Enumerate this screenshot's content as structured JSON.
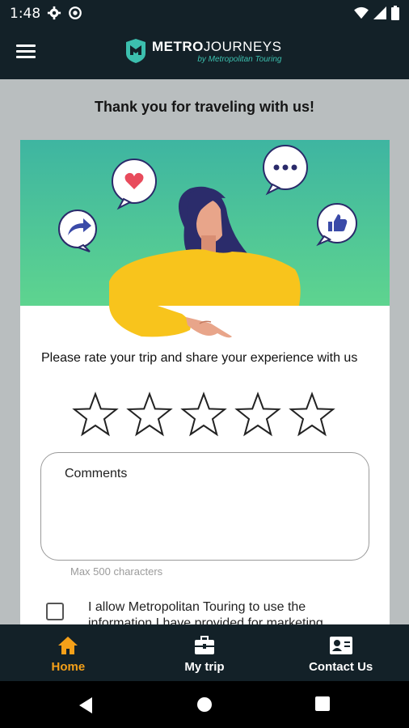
{
  "status_bar": {
    "time": "1:48",
    "left_icons": [
      "gear-icon",
      "sync-icon"
    ],
    "right_icons": [
      "wifi-icon",
      "signal-icon",
      "battery-icon"
    ]
  },
  "app_bar": {
    "menu_icon": "hamburger-menu-icon",
    "logo_bold": "METRO",
    "logo_light": "JOURNEYS",
    "logo_sub": "by Metropolitan Touring"
  },
  "page": {
    "title": "Thank you for traveling with us!"
  },
  "rating": {
    "prompt": "Please rate your trip and share your experience with us",
    "stars_total": 5,
    "stars_selected": 0
  },
  "comments": {
    "label": "Comments",
    "value": "",
    "helper": "Max 500 characters"
  },
  "consent": {
    "text": "I allow Metropolitan Touring to use the information I have provided for marketing",
    "checked": false
  },
  "bottom_nav": {
    "items": [
      {
        "label": "Home",
        "icon": "home-icon",
        "active": true
      },
      {
        "label": "My trip",
        "icon": "briefcase-icon",
        "active": false
      },
      {
        "label": "Contact Us",
        "icon": "contact-card-icon",
        "active": false
      }
    ]
  },
  "colors": {
    "bar_bg": "#132128",
    "accent": "#f4a019",
    "brand_teal": "#3cbfae",
    "page_bg": "#b9bebf"
  }
}
